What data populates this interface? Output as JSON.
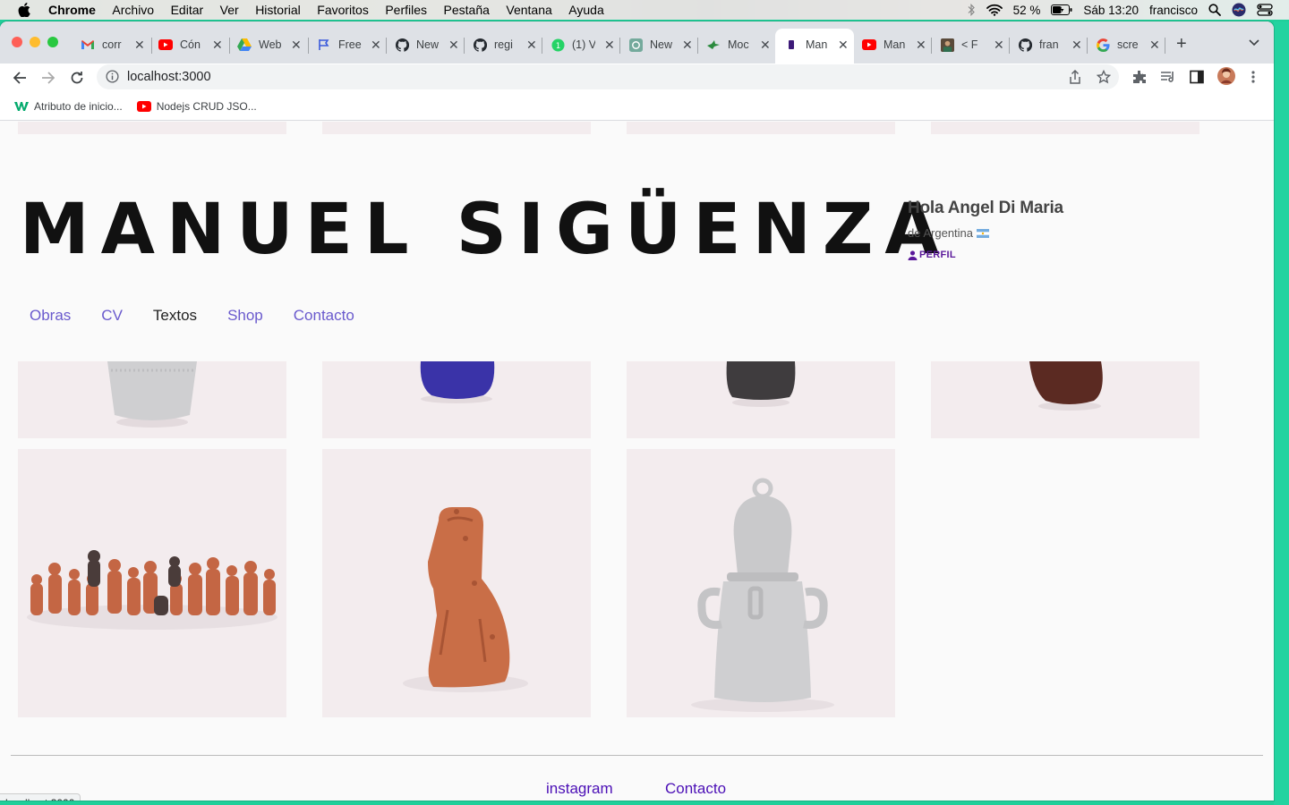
{
  "menubar": {
    "app": "Chrome",
    "items": [
      "Archivo",
      "Editar",
      "Ver",
      "Historial",
      "Favoritos",
      "Perfiles",
      "Pestaña",
      "Ventana",
      "Ayuda"
    ],
    "battery": "52 %",
    "clock": "Sáb 13:20",
    "user": "francisco"
  },
  "tabs": [
    {
      "label": "corr",
      "icon": "gmail-icon"
    },
    {
      "label": "Cón",
      "icon": "youtube-icon"
    },
    {
      "label": "Web",
      "icon": "drive-icon"
    },
    {
      "label": "Free",
      "icon": "flag-icon"
    },
    {
      "label": "New",
      "icon": "github-icon"
    },
    {
      "label": "regi",
      "icon": "github-icon"
    },
    {
      "label": "(1) V",
      "icon": "whatsapp-icon"
    },
    {
      "label": "New",
      "icon": "openai-icon"
    },
    {
      "label": "Moc",
      "icon": "bird-icon"
    },
    {
      "label": "Man",
      "icon": "site-icon"
    },
    {
      "label": "Man",
      "icon": "youtube-icon"
    },
    {
      "label": "< F",
      "icon": "photo-icon"
    },
    {
      "label": "fran",
      "icon": "github-icon"
    },
    {
      "label": "scre",
      "icon": "google-icon"
    }
  ],
  "address": "localhost:3000",
  "bookmarks": [
    {
      "label": "Atributo de inicio...",
      "icon": "w3-icon"
    },
    {
      "label": "Nodejs CRUD JSO...",
      "icon": "youtube-icon"
    }
  ],
  "site": {
    "title": "MANUEL SIGÜENZA",
    "greeting": "Hola Angel Di Maria",
    "country": "de Argentina",
    "profile_label": "PERFIL",
    "nav": [
      "Obras",
      "CV",
      "Textos",
      "Shop",
      "Contacto"
    ],
    "active_nav": "Textos",
    "footer": [
      "instagram",
      "Contacto"
    ]
  },
  "status_url": "localhost:3000",
  "colors": {
    "accent": "#6a5acd",
    "footer_link": "#4b0fb6",
    "profile": "#5a189a",
    "tile_bg": "#f3ecee"
  }
}
